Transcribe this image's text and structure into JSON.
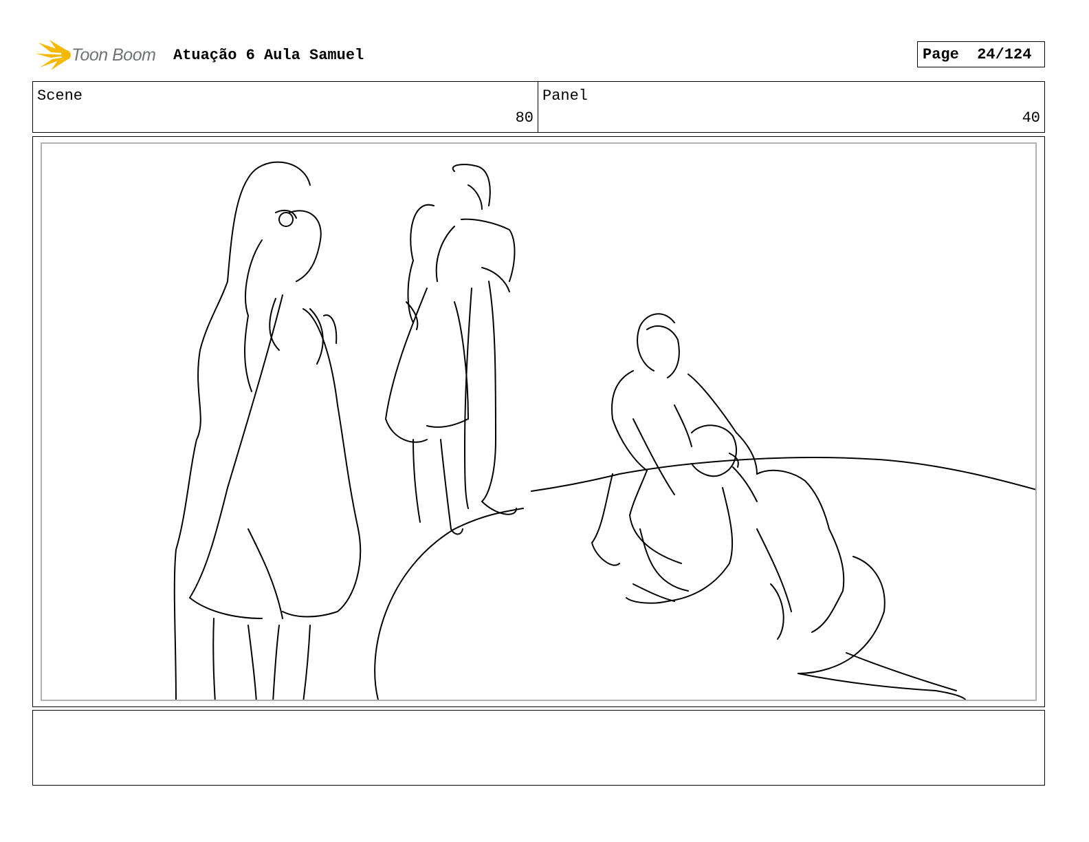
{
  "header": {
    "logo_text": "Toon Boom",
    "title": "Atuação 6 Aula Samuel",
    "page_label": "Page",
    "page_value": "24/124"
  },
  "info": {
    "scene_label": "Scene",
    "scene_value": "80",
    "panel_label": "Panel",
    "panel_value": "40"
  },
  "notes": {
    "text": ""
  },
  "colors": {
    "logo_accent": "#f5b800",
    "logo_text": "#6f7276",
    "frame_border": "#b0b0b0"
  }
}
